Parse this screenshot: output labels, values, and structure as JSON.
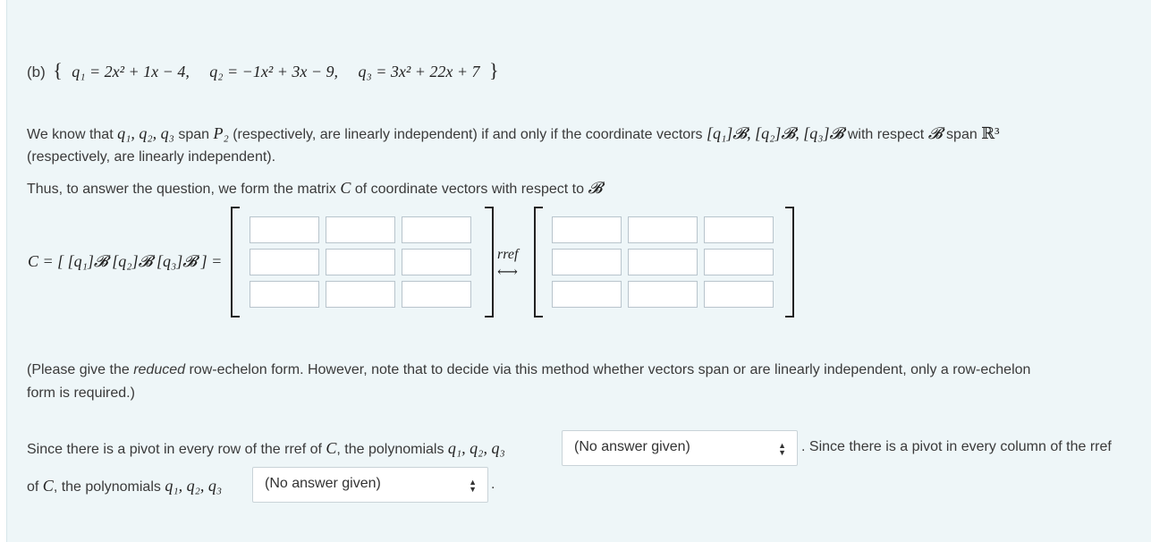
{
  "part_b": {
    "prefix": "(b)",
    "open_brace": "{",
    "close_brace": "}",
    "q1": "q₁ = 2x² + 1x − 4,",
    "q2": "q₂ = −1x² + 3x − 9,",
    "q3": "q₃ = 3x² + 22x + 7"
  },
  "para1": {
    "t1": "We know that",
    "m1": "q₁, q₂, q₃",
    "t2": "span",
    "m2": "P₂",
    "t3": "(respectively, are  linearly independent)  if and only if the coordinate vectors",
    "m3": "[q₁]𝓑, [q₂]𝓑, [q₃]𝓑",
    "t4": "with respect",
    "m4": "𝓑",
    "t5": "span",
    "m5": "ℝ³",
    "line2": "(respectively, are linearly independent)."
  },
  "para2": {
    "t1": "Thus, to answer the question, we form the matrix",
    "m1": "C",
    "t2": "of coordinate vectors with respect to",
    "m2": "𝓑"
  },
  "matrix_eq": {
    "lhs": "C = [ [q₁]𝓑 [q₂]𝓑 [q₃]𝓑 ] =",
    "rref_label": "rref",
    "arrow": "⟷"
  },
  "note": {
    "t1": "(Please give the",
    "em": "reduced",
    "t2": "row-echelon form. However, note that to decide via this method whether vectors span or are linearly independent, only a row-echelon",
    "line2": "form is required.)"
  },
  "answer": {
    "t1": "Since there is a pivot in every row of the rref of",
    "m1": "C",
    "t2": ", the polynomials",
    "m2": "q₁, q₂, q₃",
    "select1": "(No answer given)",
    "t3": ". Since there is a pivot in every column of the rref",
    "t4": "of",
    "m3": "C",
    "t5": ", the polynomials",
    "m4": "q₁, q₂, q₃",
    "select2": "(No answer given)",
    "t6": "."
  },
  "icons": {
    "select_arrow": "updown-arrow-icon"
  }
}
